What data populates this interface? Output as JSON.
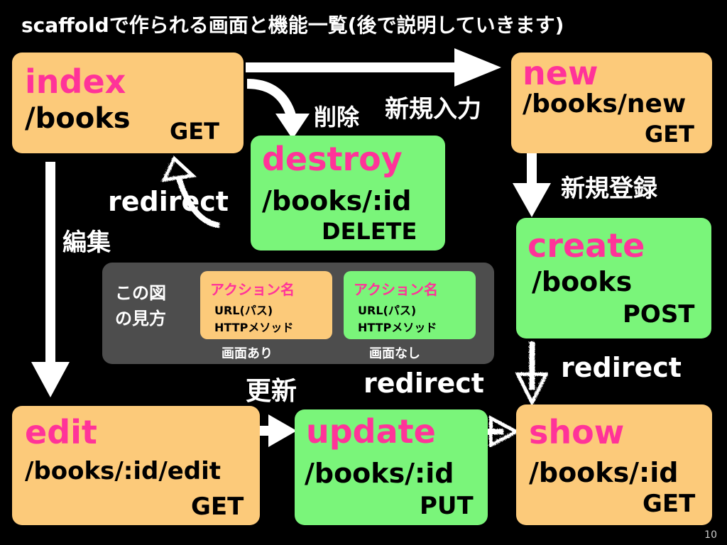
{
  "title": "scaffoldで作られる画面と機能一覧(後で説明していきます)",
  "actions": {
    "index": {
      "name": "index",
      "path": "/books",
      "method": "GET"
    },
    "new": {
      "name": "new",
      "path": "/books/new",
      "method": "GET"
    },
    "destroy": {
      "name": "destroy",
      "path": "/books/:id",
      "method": "DELETE"
    },
    "create": {
      "name": "create",
      "path": "/books",
      "method": "POST"
    },
    "edit": {
      "name": "edit",
      "path": "/books/:id/edit",
      "method": "GET"
    },
    "update": {
      "name": "update",
      "path": "/books/:id",
      "method": "PUT"
    },
    "show": {
      "name": "show",
      "path": "/books/:id",
      "method": "GET"
    }
  },
  "labels": {
    "delete": "削除",
    "new_input": "新規入力",
    "new_register": "新規登録",
    "edit": "編集",
    "update": "更新",
    "redirect_destroy": "redirect",
    "redirect_create": "redirect",
    "redirect_update": "redirect"
  },
  "legend": {
    "heading_line1": "この図",
    "heading_line2": "の見方",
    "with_screen": {
      "name": "アクション名",
      "url": "URL(パス)",
      "method": "HTTPメソッド",
      "caption": "画面あり"
    },
    "without_screen": {
      "name": "アクション名",
      "url": "URL(パス)",
      "method": "HTTPメソッド",
      "caption": "画面なし"
    }
  },
  "colors": {
    "screen_box": "#fcca7a",
    "no_screen_box": "#7af57a",
    "action_name": "#ff3399",
    "background": "#000000"
  },
  "page_number": "10"
}
